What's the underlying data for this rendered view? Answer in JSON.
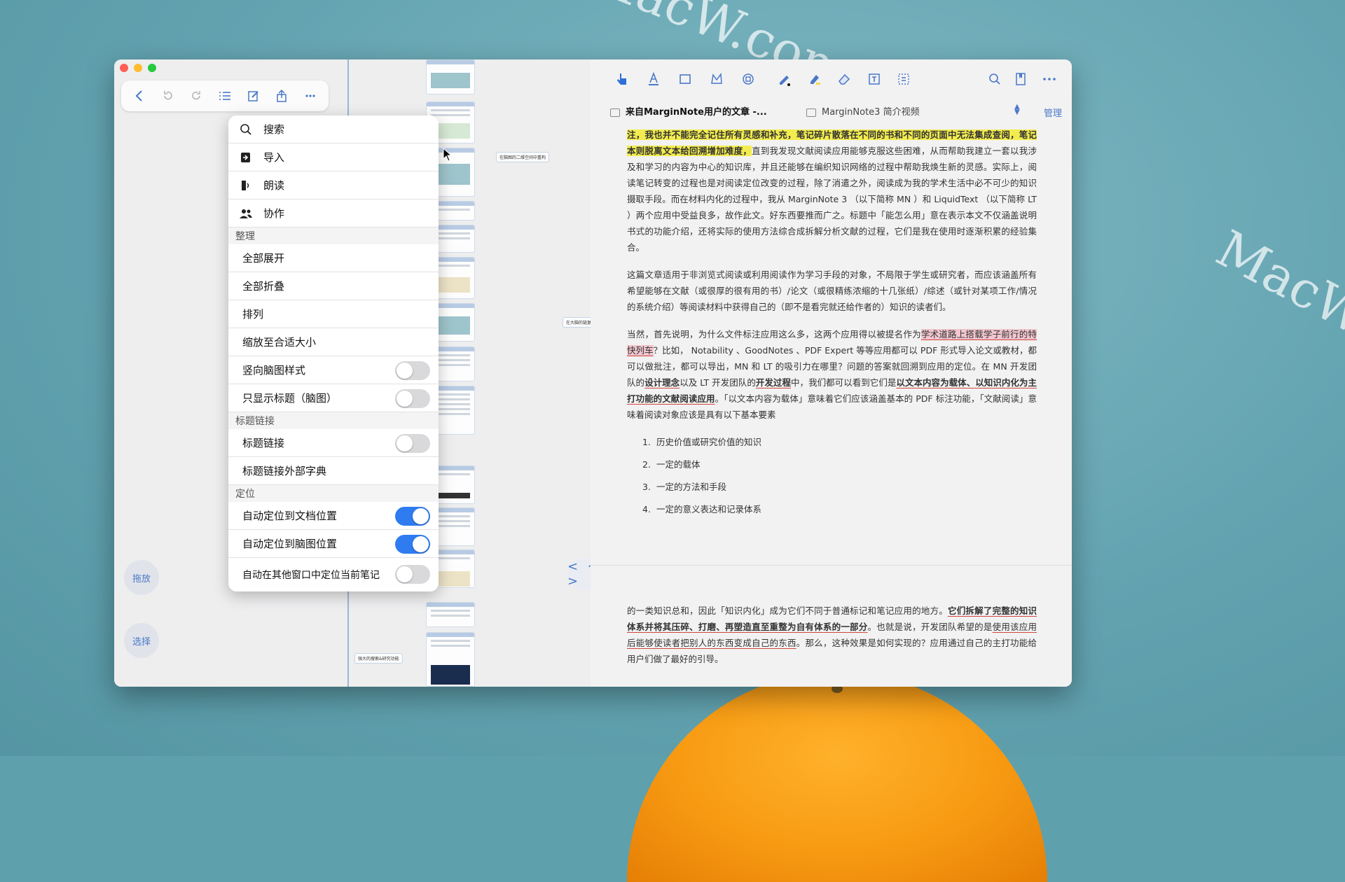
{
  "background": {
    "accent": "#5fa0ad",
    "orange": "#f79a12"
  },
  "watermark": {
    "text": "MacW.com"
  },
  "left_pane": {
    "toolbar_icons": [
      "back-icon",
      "undo-icon",
      "redo-icon",
      "outline-list-icon",
      "edit-icon",
      "share-icon",
      "more-icon"
    ],
    "side_buttons": {
      "drag": "拖放",
      "select": "选择"
    },
    "nav_arrows": "< · >",
    "mindmap_nodes": [
      "在脑图的二维空间中重构",
      "在大脑的链复点",
      "强大的搜索&研究功能"
    ]
  },
  "menu": {
    "items_top": [
      {
        "label": "搜索",
        "icon": "search-icon"
      },
      {
        "label": "导入",
        "icon": "import-icon"
      },
      {
        "label": "朗读",
        "icon": "read-aloud-icon"
      },
      {
        "label": "协作",
        "icon": "collaborate-icon"
      }
    ],
    "section_organize": "整理",
    "organize_items": [
      "全部展开",
      "全部折叠",
      "排列",
      "缩放至合适大小"
    ],
    "vertical_mindmap": {
      "label": "竖向脑图样式",
      "on": false
    },
    "titles_only": {
      "label": "只显示标题（脑图）",
      "on": false
    },
    "section_title_link": "标题链接",
    "title_link": {
      "label": "标题链接",
      "on": false
    },
    "title_link_dict": "标题链接外部字典",
    "section_locate": "定位",
    "auto_doc": {
      "label": "自动定位到文档位置",
      "on": true
    },
    "auto_mindmap": {
      "label": "自动定位到脑图位置",
      "on": true
    },
    "auto_other": {
      "label": "自动在其他窗口中定位当前笔记",
      "on": false
    }
  },
  "right_pane": {
    "toolbar_icons": [
      "hand-pointer-icon",
      "text-highlight-icon",
      "rect-select-icon",
      "lasso-icon",
      "crop-icon",
      "pen-icon",
      "highlighter-icon",
      "eraser-icon",
      "textbox-icon",
      "frame-select-icon",
      "search-icon",
      "bookmark-icon",
      "more-icon"
    ],
    "tab_active": "来自MarginNote用户的文章 -...",
    "tab_inactive": "MarginNote3 简介视频",
    "manage": "管理",
    "para1_hl": "注，我也并不能完全记住所有灵感和补充，笔记碎片散落在不同的书和不同的页面中无法集成查阅，笔记本则脱离文本给回溯增加难度，",
    "para1_rest": "直到我发现文献阅读应用能够克服这些困难，从而帮助我建立一套以我涉及和学习的内容为中心的知识库，并且还能够在编织知识网络的过程中帮助我焕生新的灵感。实际上，阅读笔记转变的过程也是对阅读定位改变的过程，除了消遣之外，阅读成为我的学术生活中必不可少的知识摄取手段。而在材料内化的过程中，我从 MarginNote 3 （以下简称 MN ）和 LiquidText （以下简称 LT ）两个应用中受益良多，故作此文。好东西要推而广之。标题中「能怎么用」意在表示本文不仅涵盖说明书式的功能介绍，还将实际的使用方法综合成拆解分析文献的过程，它们是我在使用时逐渐积累的经验集合。",
    "para2": "这篇文章适用于非浏览式阅读或利用阅读作为学习手段的对象，不局限于学生或研究者，而应该涵盖所有希望能够在文献（或很厚的很有用的书）/论文（或很精练浓缩的十几张纸）/综述（或针对某项工作/情况的系统介绍）等阅读材料中获得自己的（即不是看完就还给作者的）知识的读者们。",
    "para3_a": "当然，首先说明，为什么文件标注应用这么多，这两个应用得以被提名作为",
    "para3_hl": "学术道路上搭载学子前行的特快列车",
    "para3_b": "？比如， Notability 、GoodNotes 、PDF Expert 等等应用都可以 PDF 形式导入论文或教材，都可以做批注，都可以导出，MN 和 LT 的吸引力在哪里？问题的答案就回溯到应用的定位。在 MN 开发团队的",
    "para3_c": "设计理念",
    "para3_d": "以及 LT 开发团队的",
    "para3_e": "开发过程",
    "para3_f": "中，我们都可以看到它们是",
    "para3_g": "以文本内容为载体、以知识内化为主打功能的文献阅读应用",
    "para3_h": "。「以文本内容为载体」意味着它们应该涵盖基本的 PDF 标注功能，「文献阅读」意味着阅读对象应该是具有以下基本要素",
    "list": [
      {
        "num": "1.",
        "text": "历史价值或研究价值的知识"
      },
      {
        "num": "2.",
        "text": "一定的载体"
      },
      {
        "num": "3.",
        "text": "一定的方法和手段"
      },
      {
        "num": "4.",
        "text": "一定的意义表达和记录体系"
      }
    ],
    "para4_a": "的一类知识总和，因此「知识内化」成为它们不同于普通标记和笔记应用的地方。",
    "para4_b": "它们拆解了完整的知识体系并将其压碎、打磨、再塑造直至重整为自有体系的一部分",
    "para4_c": "。也就是说，开发团队希望的是",
    "para4_d": "使用该应用后能够使读者把别人的东西变成自己的东西",
    "para4_e": "。那么，这种效果是如何实现的？应用通过自己的主打功能给用户们做了最好的引导。"
  }
}
